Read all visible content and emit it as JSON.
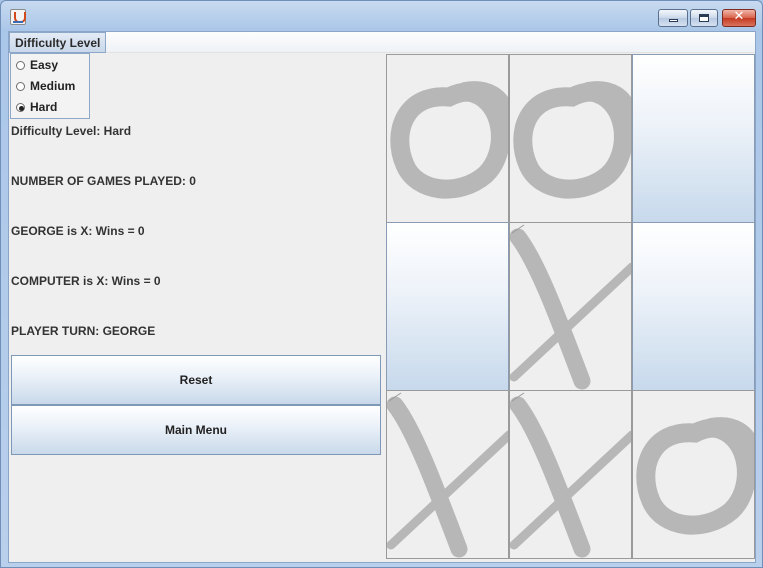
{
  "menu": {
    "difficulty_label": "Difficulty Level"
  },
  "difficulty_options": [
    {
      "label": "Easy",
      "selected": false
    },
    {
      "label": "Medium",
      "selected": false
    },
    {
      "label": "Hard",
      "selected": true
    }
  ],
  "status": {
    "difficulty": "Difficulty Level: Hard",
    "games_played": "NUMBER OF GAMES PLAYED: 0",
    "player_x": "GEORGE is X: Wins = 0",
    "computer_x": "COMPUTER is X: Wins = 0",
    "turn": "PLAYER TURN: GEORGE"
  },
  "buttons": {
    "reset": "Reset",
    "main_menu": "Main Menu"
  },
  "board": [
    [
      "O",
      "O",
      ""
    ],
    [
      "",
      "X",
      ""
    ],
    [
      "X",
      "X",
      "O"
    ]
  ],
  "colors": {
    "mark": "#b7b7b7"
  }
}
